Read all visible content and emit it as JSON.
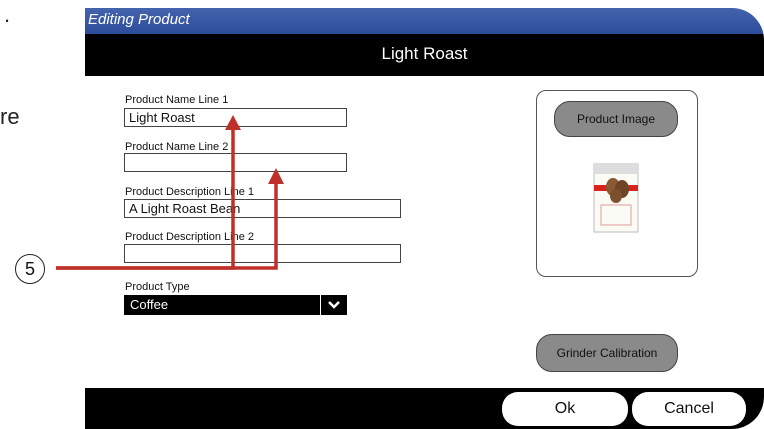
{
  "fragments": {
    "top": ".",
    "mid": "re"
  },
  "title_bar": {
    "title": "Editing Product"
  },
  "header": {
    "product_title": "Light Roast"
  },
  "form": {
    "name_line1": {
      "label": "Product Name Line 1",
      "value": "Light Roast"
    },
    "name_line2": {
      "label": "Product Name Line 2",
      "value": ""
    },
    "desc_line1": {
      "label": "Product Description Line 1",
      "value": "A Light Roast Bean"
    },
    "desc_line2": {
      "label": "Product Description Line 2",
      "value": ""
    },
    "product_type": {
      "label": "Product Type",
      "value": "Coffee"
    }
  },
  "image_panel": {
    "button_label": "Product Image"
  },
  "grinder": {
    "button_label": "Grinder Calibration"
  },
  "footer": {
    "ok_label": "Ok",
    "cancel_label": "Cancel"
  },
  "callout": {
    "number": "5"
  },
  "colors": {
    "title_bar": "#3a5aa6",
    "arrow": "#c0302b",
    "button_gray": "#8a8a8a"
  }
}
